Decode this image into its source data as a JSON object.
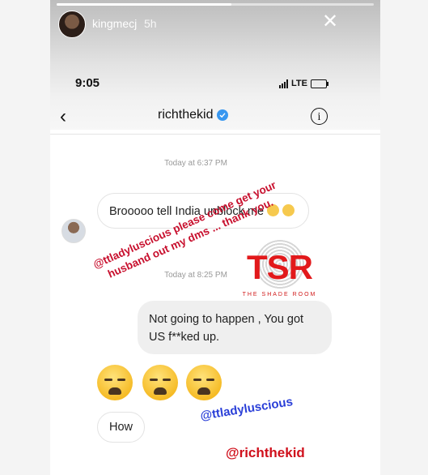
{
  "story": {
    "username": "kingmecj",
    "time_ago": "5h",
    "progress": 0.55
  },
  "phone_status": {
    "time": "9:05",
    "network": "LTE"
  },
  "dm_header": {
    "title": "richthekid",
    "info_glyph": "i"
  },
  "timestamps": [
    "Today at 6:37 PM",
    "Today at 8:25 PM"
  ],
  "messages": {
    "incoming_1": "Brooooo tell India unblock me",
    "outgoing_1": "Not going to happen , You got US f**ked up.",
    "incoming_2": "How"
  },
  "overlay": {
    "text": "@ttladyluscious please come get your husband out my dms ... thank you.",
    "watermark_letters": "TSR",
    "watermark_sub": "THE SHADE ROOM"
  },
  "mentions": [
    "@ttladyluscious",
    "@richthekid"
  ],
  "colors": {
    "overlay_red": "#c8102e",
    "mention_blue": "#2a3fd8",
    "verified_blue": "#3897f0"
  },
  "icons": [
    "close-icon",
    "back-arrow-icon",
    "verified-badge-icon",
    "info-icon",
    "signal-icon",
    "battery-icon"
  ]
}
